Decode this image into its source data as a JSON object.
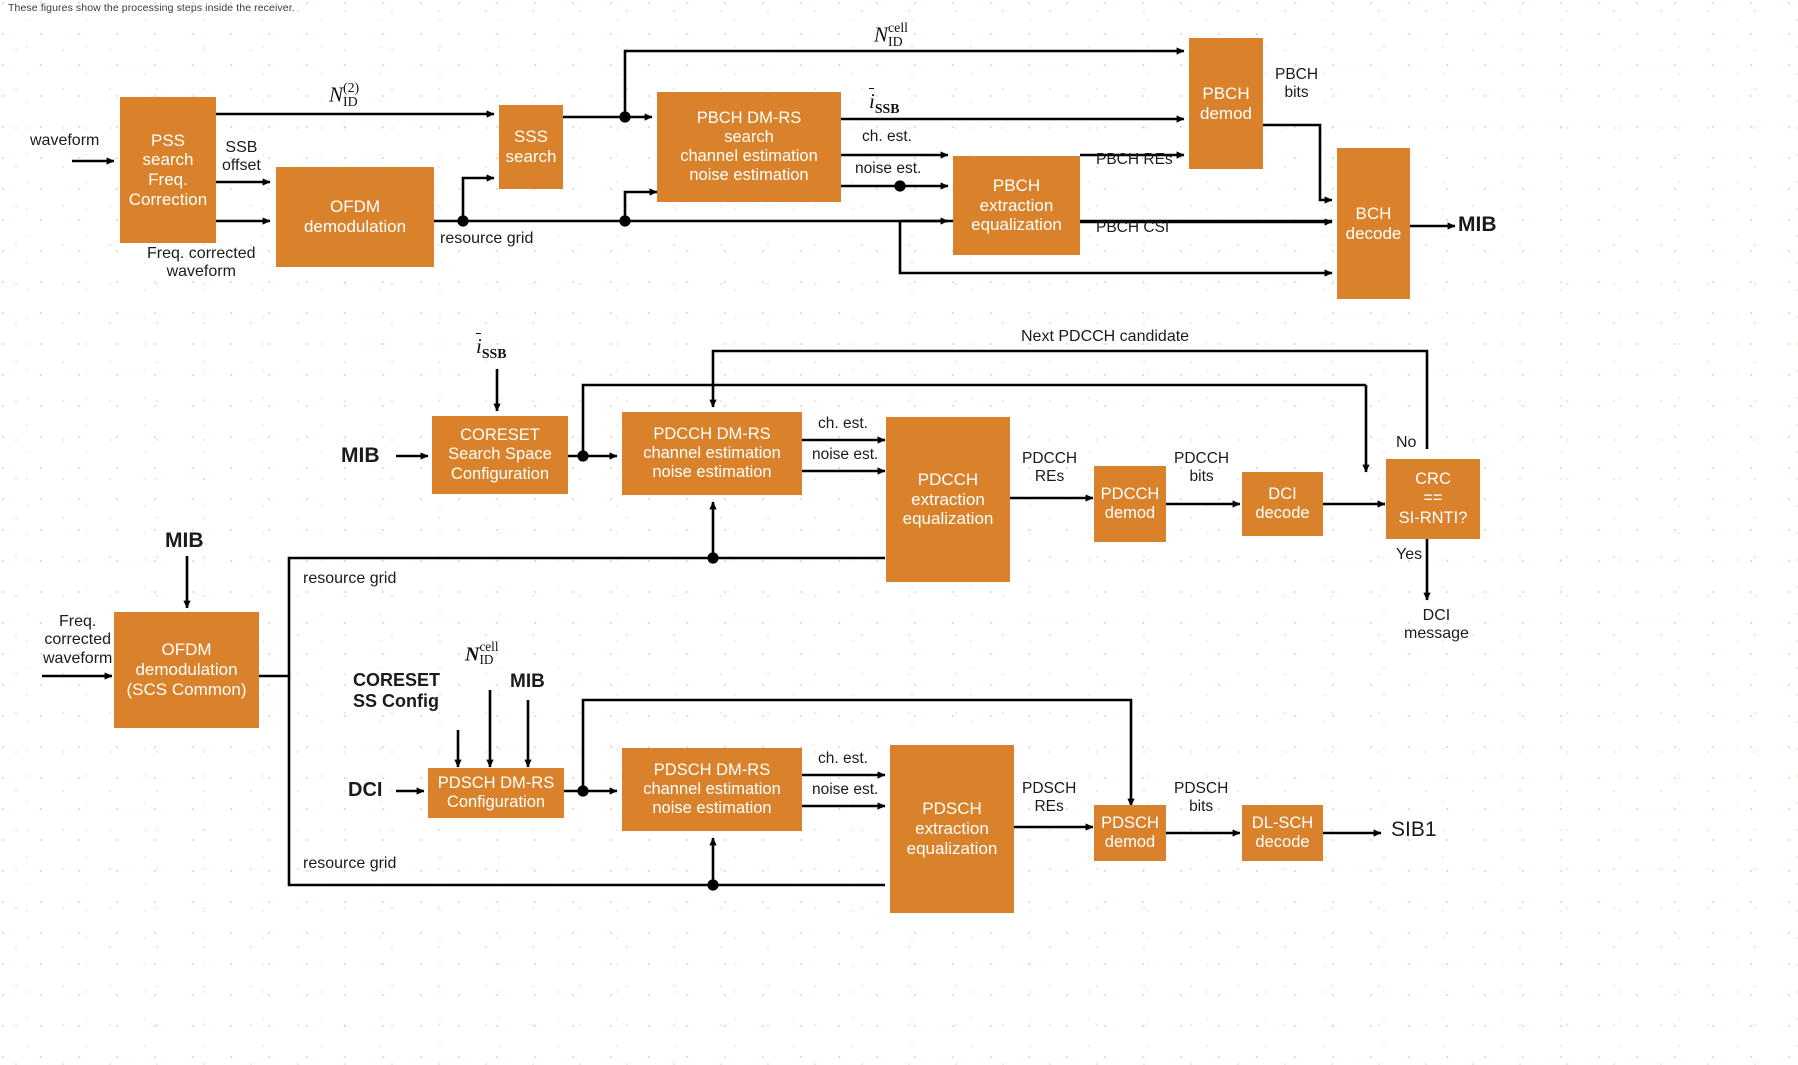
{
  "caption": "These figures show the processing steps inside the receiver.",
  "colors": {
    "block_fill": "#d9822b",
    "block_text": "#ffffff",
    "line": "#000000",
    "label_text": "#1b1b1b",
    "background": "#ffffff"
  },
  "diagram1": {
    "name": "SSB / PBCH / MIB decode chain",
    "blocks": [
      {
        "id": "pss-search",
        "lines": [
          "PSS",
          "search",
          "Freq.",
          "Correction"
        ]
      },
      {
        "id": "ofdm-demod",
        "lines": [
          "OFDM",
          "demodulation"
        ]
      },
      {
        "id": "sss-search",
        "lines": [
          "SSS",
          "search"
        ]
      },
      {
        "id": "pbch-dmrs",
        "lines": [
          "PBCH DM-RS",
          "search",
          "channel estimation",
          "noise estimation"
        ]
      },
      {
        "id": "pbch-extraction",
        "lines": [
          "PBCH",
          "extraction",
          "equalization"
        ]
      },
      {
        "id": "pbch-demod",
        "lines": [
          "PBCH",
          "demod"
        ]
      },
      {
        "id": "bch-decode",
        "lines": [
          "BCH",
          "decode"
        ]
      }
    ],
    "labels": {
      "waveform": "waveform",
      "ssb_offset": [
        "SSB",
        "offset"
      ],
      "freq_corrected_waveform": [
        "Freq. corrected",
        "waveform"
      ],
      "resource_grid": "resource grid",
      "ch_est": "ch. est.",
      "noise_est": "noise est.",
      "pbch_res": "PBCH REs",
      "pbch_csi": "PBCH CSI",
      "pbch_bits": [
        "PBCH",
        "bits"
      ],
      "mib_out": "MIB",
      "n_id_2": "N_ID^(2)",
      "n_id_cell": "N_ID^cell",
      "i_ssb": "ī_SSB"
    }
  },
  "diagram2": {
    "name": "PDCCH / DCI decode chain",
    "blocks": [
      {
        "id": "coreset-config",
        "lines": [
          "CORESET",
          "Search Space",
          "Configuration"
        ]
      },
      {
        "id": "pdcch-dmrs",
        "lines": [
          "PDCCH DM-RS",
          "channel estimation",
          "noise estimation"
        ]
      },
      {
        "id": "pdcch-extraction",
        "lines": [
          "PDCCH",
          "extraction",
          "equalization"
        ]
      },
      {
        "id": "pdcch-demod",
        "lines": [
          "PDCCH",
          "demod"
        ]
      },
      {
        "id": "dci-decode",
        "lines": [
          "DCI",
          "decode"
        ]
      },
      {
        "id": "crc-check",
        "lines": [
          "CRC",
          "==",
          "SI-RNTI?"
        ]
      }
    ],
    "labels": {
      "i_ssb": "ī_SSB",
      "mib_in": "MIB",
      "next_pdcch_candidate": "Next PDCCH candidate",
      "ch_est": "ch. est.",
      "noise_est": "noise est.",
      "pdcch_res": [
        "PDCCH",
        "REs"
      ],
      "pdcch_bits": [
        "PDCCH",
        "bits"
      ],
      "no": "No",
      "yes": "Yes",
      "dci_message": [
        "DCI",
        "message"
      ],
      "resource_grid": "resource grid"
    }
  },
  "diagram3": {
    "name": "PDSCH / SIB1 decode chain",
    "blocks": [
      {
        "id": "ofdm-demod-scs",
        "lines": [
          "OFDM",
          "demodulation",
          "(SCS Common)"
        ]
      },
      {
        "id": "pdsch-dmrs-config",
        "lines": [
          "PDSCH DM-RS",
          "Configuration"
        ]
      },
      {
        "id": "pdsch-dmrs-est",
        "lines": [
          "PDSCH DM-RS",
          "channel estimation",
          "noise estimation"
        ]
      },
      {
        "id": "pdsch-extraction",
        "lines": [
          "PDSCH",
          "extraction",
          "equalization"
        ]
      },
      {
        "id": "pdsch-demod",
        "lines": [
          "PDSCH",
          "demod"
        ]
      },
      {
        "id": "dlsch-decode",
        "lines": [
          "DL-SCH",
          "decode"
        ]
      }
    ],
    "labels": {
      "mib_in": "MIB",
      "freq_corrected_waveform": [
        "Freq.",
        "corrected",
        "waveform"
      ],
      "coreset_ss_config": [
        "CORESET",
        "SS Config"
      ],
      "n_id_cell": "N_ID^cell",
      "mib_cfg": "MIB",
      "dci_in": "DCI",
      "ch_est": "ch. est.",
      "noise_est": "noise est.",
      "pdsch_res": [
        "PDSCH",
        "REs"
      ],
      "pdsch_bits": [
        "PDSCH",
        "bits"
      ],
      "sib1_out": "SIB1",
      "resource_grid": "resource grid"
    }
  }
}
